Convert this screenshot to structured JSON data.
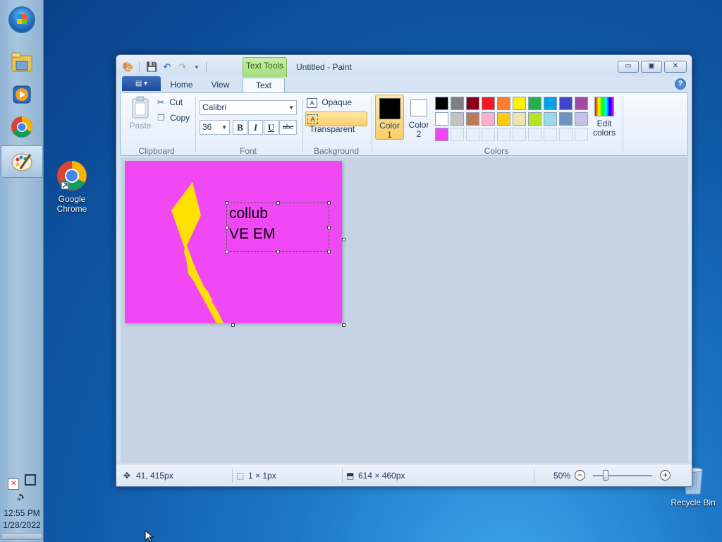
{
  "taskbar": {
    "clock": {
      "time": "12:55 PM",
      "date": "1/28/2022"
    },
    "pinned": [
      "start-orb",
      "file-explorer-icon",
      "media-player-icon",
      "chrome-icon",
      "paint-icon"
    ]
  },
  "desktop": {
    "icons": [
      {
        "label_line1": "Google",
        "label_line2": "Chrome"
      },
      {
        "label": "Recycle Bin"
      }
    ]
  },
  "window": {
    "title": "Untitled - Paint",
    "context_tab": "Text Tools",
    "tabs": [
      "Home",
      "View",
      "Text"
    ],
    "active_tab": "Text",
    "minimize": "▭",
    "maximize": "▣",
    "close": "✕"
  },
  "ribbon": {
    "clipboard": {
      "paste": "Paste",
      "cut": "Cut",
      "copy": "Copy",
      "label": "Clipboard"
    },
    "font": {
      "family": "Calibri",
      "size": "36",
      "bold": "B",
      "italic": "I",
      "underline": "U",
      "strike": "abc",
      "label": "Font"
    },
    "background": {
      "opaque": "Opaque",
      "transparent": "Transparent",
      "label": "Background"
    },
    "colors": {
      "color1_line1": "Color",
      "color1_line2": "1",
      "color2_line1": "Color",
      "color2_line2": "2",
      "edit_line1": "Edit",
      "edit_line2": "colors",
      "label": "Colors",
      "color1_value": "#000000",
      "color2_value": "#ffffff",
      "palette_row1": [
        "#000000",
        "#7f7f7f",
        "#880015",
        "#ed1c24",
        "#ff7f27",
        "#fff200",
        "#22b14c",
        "#00a2e8",
        "#3f48cc",
        "#a349a4"
      ],
      "palette_row2": [
        "#ffffff",
        "#c3c3c3",
        "#b97a57",
        "#ffaec9",
        "#ffc90e",
        "#efe4b0",
        "#b5e61d",
        "#99d9ea",
        "#7092be",
        "#c8bfe7"
      ],
      "palette_row3": [
        "#f048f5",
        "",
        "",
        "",
        "",
        "",
        "",
        "",
        "",
        ""
      ]
    }
  },
  "canvas": {
    "background": "#f048f5",
    "text_line1": "collub",
    "text_line2": "VE EM"
  },
  "status": {
    "cursor_pos": "41, 415px",
    "selection_size": "1 × 1px",
    "image_size": "614 × 460px",
    "zoom": "50%"
  }
}
